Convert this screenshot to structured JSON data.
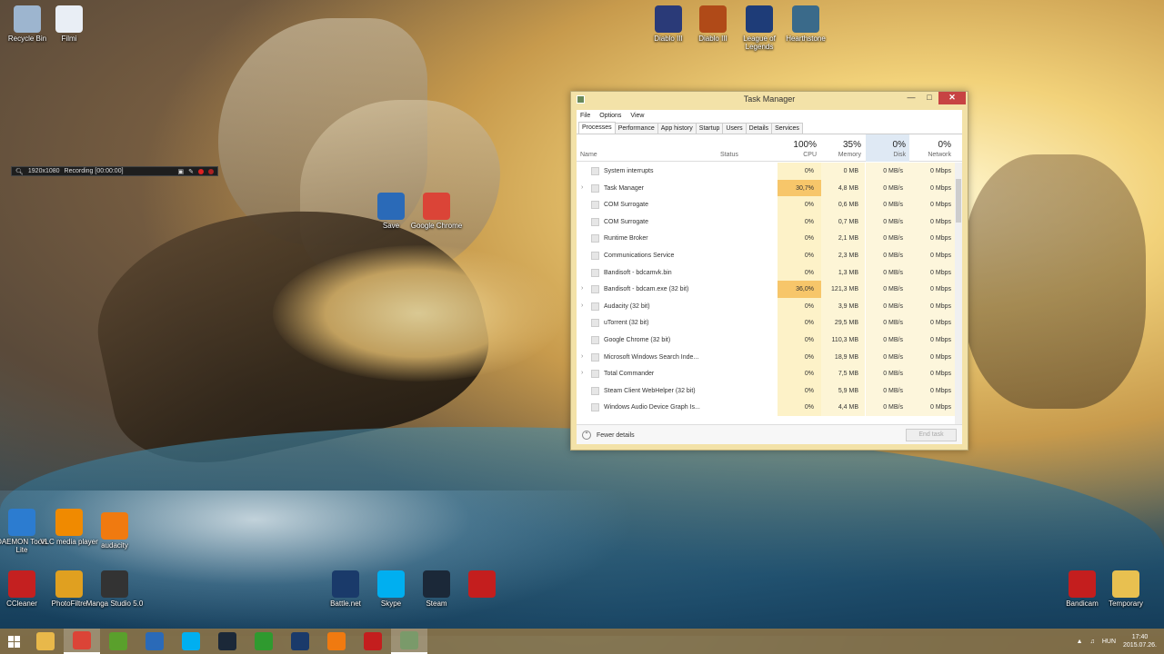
{
  "desktop_icons_top": [
    {
      "label": "Recycle Bin",
      "icon": "recycle-bin-icon",
      "color": "#9db5cf"
    },
    {
      "label": "Filmi",
      "icon": "file-icon",
      "color": "#e9eef5"
    }
  ],
  "desktop_icons_games": [
    {
      "label": "Diablo III",
      "icon": "diablo-icon",
      "color": "#2a3a78"
    },
    {
      "label": "Diablo III",
      "icon": "diablo-d-icon",
      "color": "#b04a18"
    },
    {
      "label": "League of Legends",
      "icon": "league-icon",
      "color": "#1e3c78"
    },
    {
      "label": "Hearthstone",
      "icon": "hearthstone-icon",
      "color": "#3a6a8a"
    }
  ],
  "desktop_icons_mid": [
    {
      "label": "Save",
      "icon": "floppy-icon",
      "color": "#2a6ab8"
    },
    {
      "label": "Google Chrome",
      "icon": "chrome-icon",
      "color": "#db4437"
    }
  ],
  "desktop_icons_left": [
    {
      "label": "DAEMON Tools Lite",
      "icon": "daemon-icon",
      "color": "#2c7cd0"
    },
    {
      "label": "VLC media player",
      "icon": "vlc-icon",
      "color": "#f08a00"
    },
    {
      "label": "audacity",
      "icon": "audacity-icon",
      "color": "#f07a10"
    },
    {
      "label": "CCleaner",
      "icon": "ccleaner-icon",
      "color": "#c42020"
    },
    {
      "label": "PhotoFiltre",
      "icon": "photofiltre-icon",
      "color": "#e0a020"
    },
    {
      "label": "Manga Studio 5.0",
      "icon": "manga-icon",
      "color": "#333333"
    }
  ],
  "desktop_icons_bottom": [
    {
      "label": "Battle.net",
      "icon": "battlenet-icon",
      "color": "#1a3a6a"
    },
    {
      "label": "Skype",
      "icon": "skype-icon",
      "color": "#00aff0"
    },
    {
      "label": "Steam",
      "icon": "steam-icon",
      "color": "#1b2838"
    },
    {
      "label": "",
      "icon": "stripes-icon",
      "color": "#c41e1e"
    }
  ],
  "desktop_icons_right": [
    {
      "label": "Bandicam",
      "icon": "bandicam-icon",
      "color": "#c41e1e"
    },
    {
      "label": "Temporary",
      "icon": "folder-icon",
      "color": "#e8c050"
    }
  ],
  "recbar": {
    "resolution": "1920x1080",
    "status": "Recording [00:00:00]"
  },
  "task_manager": {
    "title": "Task Manager",
    "menu": [
      "File",
      "Options",
      "View"
    ],
    "tabs": [
      "Processes",
      "Performance",
      "App history",
      "Startup",
      "Users",
      "Details",
      "Services"
    ],
    "header": {
      "name": "Name",
      "status": "Status",
      "cpu_pct": "100%",
      "cpu": "CPU",
      "mem_pct": "35%",
      "mem": "Memory",
      "disk_pct": "0%",
      "disk": "Disk",
      "net_pct": "0%",
      "net": "Network"
    },
    "processes": [
      {
        "name": "System interrupts",
        "cpu": "0%",
        "mem": "0 MB",
        "disk": "0 MB/s",
        "net": "0 Mbps",
        "expand": false
      },
      {
        "name": "Task Manager",
        "cpu": "30,7%",
        "mem": "4,8 MB",
        "disk": "0 MB/s",
        "net": "0 Mbps",
        "expand": true
      },
      {
        "name": "COM Surrogate",
        "cpu": "0%",
        "mem": "0,6 MB",
        "disk": "0 MB/s",
        "net": "0 Mbps",
        "expand": false
      },
      {
        "name": "COM Surrogate",
        "cpu": "0%",
        "mem": "0,7 MB",
        "disk": "0 MB/s",
        "net": "0 Mbps",
        "expand": false
      },
      {
        "name": "Runtime Broker",
        "cpu": "0%",
        "mem": "2,1 MB",
        "disk": "0 MB/s",
        "net": "0 Mbps",
        "expand": false
      },
      {
        "name": "Communications Service",
        "cpu": "0%",
        "mem": "2,3 MB",
        "disk": "0 MB/s",
        "net": "0 Mbps",
        "expand": false
      },
      {
        "name": "Bandisoft - bdcamvk.bin",
        "cpu": "0%",
        "mem": "1,3 MB",
        "disk": "0 MB/s",
        "net": "0 Mbps",
        "expand": false
      },
      {
        "name": "Bandisoft - bdcam.exe (32 bit)",
        "cpu": "36,0%",
        "mem": "121,3 MB",
        "disk": "0 MB/s",
        "net": "0 Mbps",
        "expand": true
      },
      {
        "name": "Audacity (32 bit)",
        "cpu": "0%",
        "mem": "3,9 MB",
        "disk": "0 MB/s",
        "net": "0 Mbps",
        "expand": true
      },
      {
        "name": "uTorrent (32 bit)",
        "cpu": "0%",
        "mem": "29,5 MB",
        "disk": "0 MB/s",
        "net": "0 Mbps",
        "expand": false
      },
      {
        "name": "Google Chrome (32 bit)",
        "cpu": "0%",
        "mem": "110,3 MB",
        "disk": "0 MB/s",
        "net": "0 Mbps",
        "expand": false
      },
      {
        "name": "Microsoft Windows Search Inde...",
        "cpu": "0%",
        "mem": "18,9 MB",
        "disk": "0 MB/s",
        "net": "0 Mbps",
        "expand": true
      },
      {
        "name": "Total Commander",
        "cpu": "0%",
        "mem": "7,5 MB",
        "disk": "0 MB/s",
        "net": "0 Mbps",
        "expand": true
      },
      {
        "name": "Steam Client WebHelper (32 bit)",
        "cpu": "0%",
        "mem": "5,9 MB",
        "disk": "0 MB/s",
        "net": "0 Mbps",
        "expand": false
      },
      {
        "name": "Windows Audio Device Graph Is...",
        "cpu": "0%",
        "mem": "4,4 MB",
        "disk": "0 MB/s",
        "net": "0 Mbps",
        "expand": false
      }
    ],
    "footer": {
      "fewer_details": "Fewer details",
      "end_task": "End task"
    }
  },
  "taskbar": {
    "apps": [
      {
        "name": "File Explorer",
        "icon": "folder-icon",
        "color": "#e8b84a",
        "active": false
      },
      {
        "name": "Google Chrome",
        "icon": "chrome-icon",
        "color": "#db4437",
        "active": true
      },
      {
        "name": "uTorrent",
        "icon": "utorrent-icon",
        "color": "#5aa02c",
        "active": false
      },
      {
        "name": "Save",
        "icon": "floppy-icon",
        "color": "#2a6ab8",
        "active": false
      },
      {
        "name": "Skype",
        "icon": "skype-icon",
        "color": "#00aff0",
        "active": false
      },
      {
        "name": "Steam",
        "icon": "steam-icon",
        "color": "#1b2838",
        "active": false
      },
      {
        "name": "Store",
        "icon": "store-icon",
        "color": "#2f9a2f",
        "active": false
      },
      {
        "name": "Battle.net",
        "icon": "battlenet-icon",
        "color": "#1a3a6a",
        "active": false
      },
      {
        "name": "Audacity",
        "icon": "audacity-icon",
        "color": "#f07a10",
        "active": false
      },
      {
        "name": "Bandicam",
        "icon": "record-icon",
        "color": "#c41e1e",
        "active": false
      },
      {
        "name": "Task Manager",
        "icon": "task-manager-icon",
        "color": "#7a9a6a",
        "active": true
      }
    ],
    "tray": {
      "lang": "HUN",
      "time": "17:40",
      "date": "2015.07.26."
    }
  }
}
